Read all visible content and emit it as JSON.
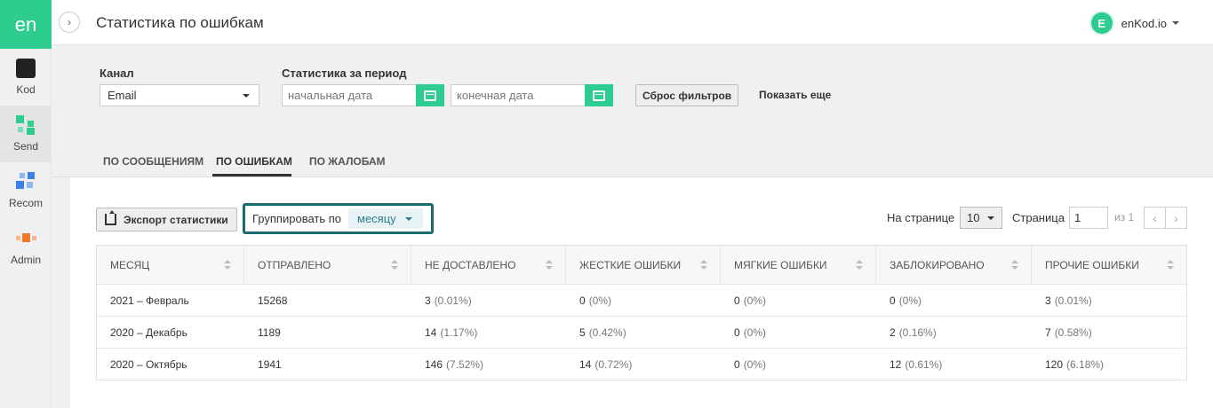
{
  "sidebar": {
    "logo": "en",
    "items": [
      {
        "label": "Kod"
      },
      {
        "label": "Send"
      },
      {
        "label": "Recom"
      },
      {
        "label": "Admin"
      }
    ]
  },
  "header": {
    "title": "Статистика по ошибкам",
    "avatar_letter": "E",
    "user_name": "enKod.io"
  },
  "filters": {
    "channel_label": "Канал",
    "channel_value": "Email",
    "period_label": "Статистика за период",
    "start_placeholder": "начальная дата",
    "end_placeholder": "конечная дата",
    "reset_label": "Сброс фильтров",
    "more_label": "Показать еще"
  },
  "tabs": [
    {
      "label": "ПО СООБЩЕНИЯМ"
    },
    {
      "label": "ПО ОШИБКАМ"
    },
    {
      "label": "ПО ЖАЛОБАМ"
    }
  ],
  "toolbar": {
    "export_label": "Экспорт статистики",
    "group_label": "Группировать по",
    "group_value": "месяцу",
    "per_page_label": "На странице",
    "per_page_value": "10",
    "page_label": "Страница",
    "page_value": "1",
    "of_label": "из 1"
  },
  "table": {
    "columns": [
      "МЕСЯЦ",
      "ОТПРАВЛЕНО",
      "НЕ ДОСТАВЛЕНО",
      "ЖЕСТКИЕ ОШИБКИ",
      "МЯГКИЕ ОШИБКИ",
      "ЗАБЛОКИРОВАНО",
      "ПРОЧИЕ ОШИБКИ"
    ],
    "rows": [
      {
        "month": "2021 – Февраль",
        "sent": "15268",
        "undelivered": "3",
        "undelivered_pct": "(0.01%)",
        "hard": "0",
        "hard_pct": "(0%)",
        "soft": "0",
        "soft_pct": "(0%)",
        "blocked": "0",
        "blocked_pct": "(0%)",
        "other": "3",
        "other_pct": "(0.01%)"
      },
      {
        "month": "2020 – Декабрь",
        "sent": "1189",
        "undelivered": "14",
        "undelivered_pct": "(1.17%)",
        "hard": "5",
        "hard_pct": "(0.42%)",
        "soft": "0",
        "soft_pct": "(0%)",
        "blocked": "2",
        "blocked_pct": "(0.16%)",
        "other": "7",
        "other_pct": "(0.58%)"
      },
      {
        "month": "2020 – Октябрь",
        "sent": "1941",
        "undelivered": "146",
        "undelivered_pct": "(7.52%)",
        "hard": "14",
        "hard_pct": "(0.72%)",
        "soft": "0",
        "soft_pct": "(0%)",
        "blocked": "12",
        "blocked_pct": "(0.61%)",
        "other": "120",
        "other_pct": "(6.18%)"
      }
    ]
  },
  "colors": {
    "accent": "#2ecc8f",
    "highlight_border": "#1a6b6b"
  }
}
